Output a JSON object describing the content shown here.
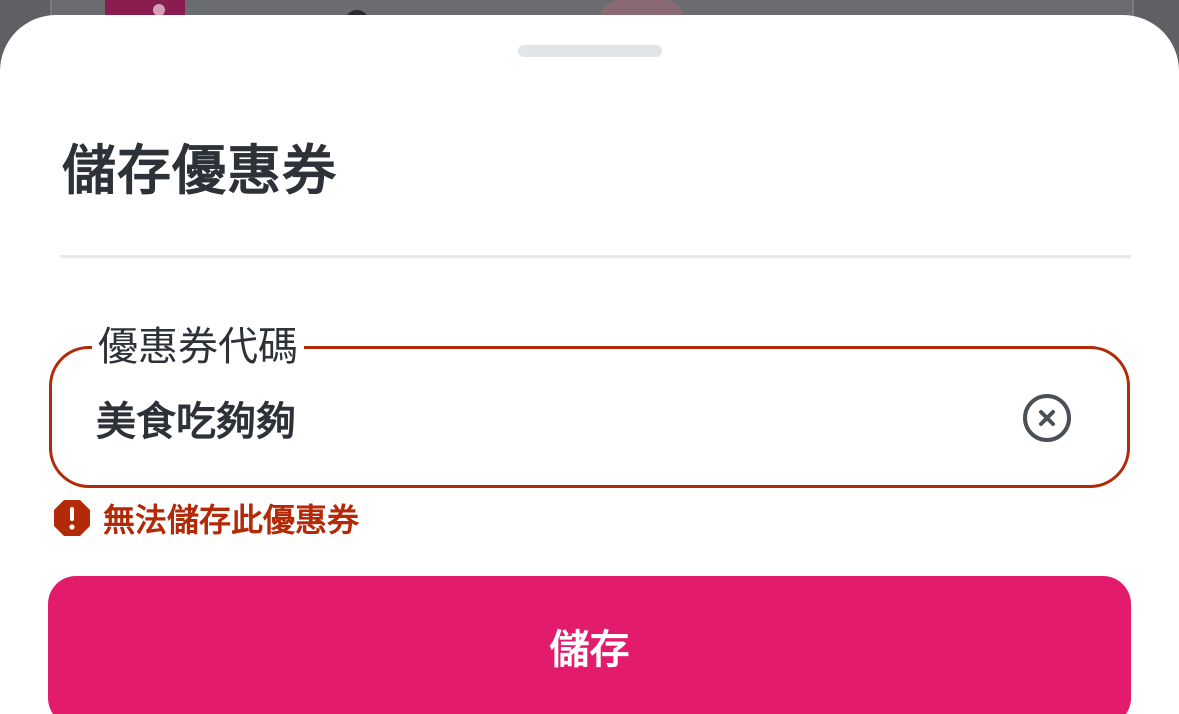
{
  "sheet": {
    "title": "儲存優惠券"
  },
  "coupon_field": {
    "label": "優惠券代碼",
    "value": "美食吃夠夠",
    "clear_icon": "clear-circle-icon",
    "border_color": "#b32a08"
  },
  "error": {
    "icon": "error-octagon-icon",
    "message": "無法儲存此優惠券",
    "color": "#b32a08"
  },
  "save_button": {
    "label": "儲存",
    "color": "#e31b6d"
  }
}
